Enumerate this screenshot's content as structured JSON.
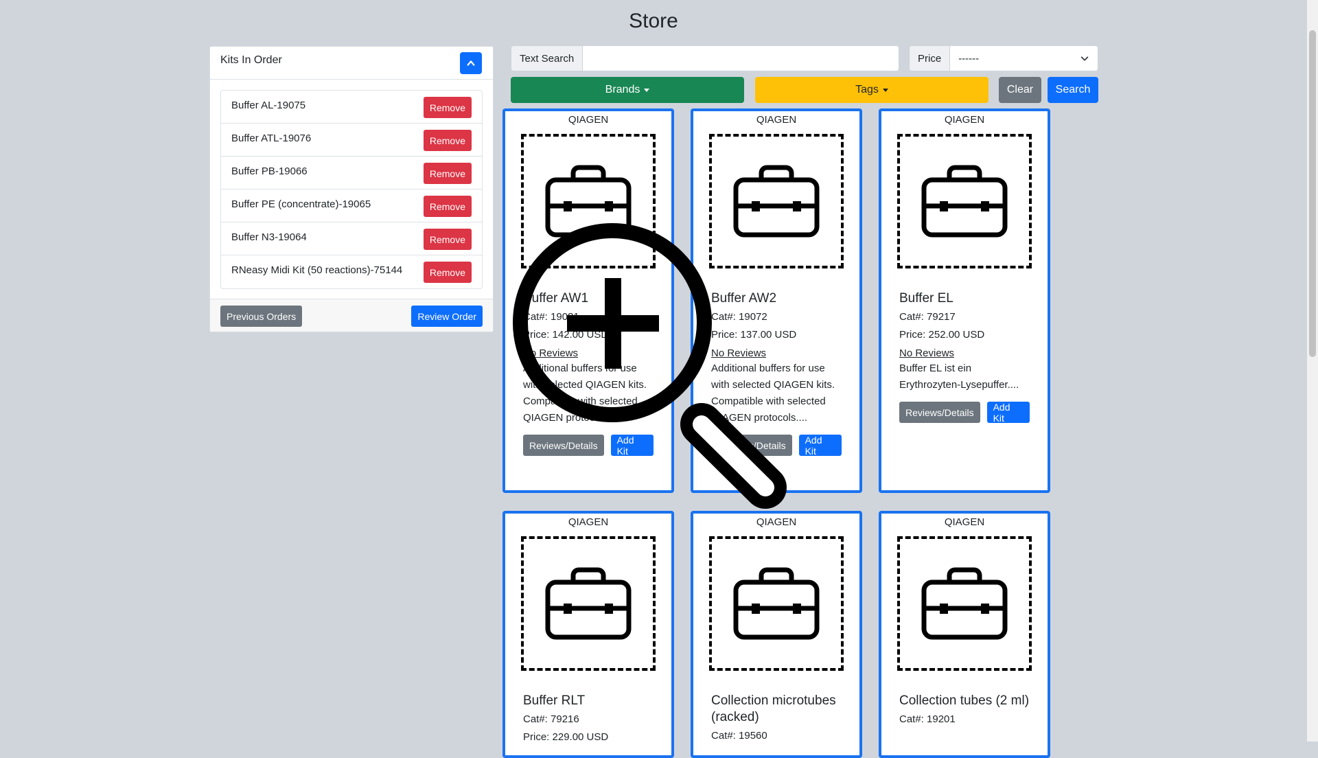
{
  "page": {
    "title": "Store"
  },
  "order_panel": {
    "title": "Kits In Order",
    "items": [
      {
        "name": "Buffer AL-19075",
        "remove_label": "Remove"
      },
      {
        "name": "Buffer ATL-19076",
        "remove_label": "Remove"
      },
      {
        "name": "Buffer PB-19066",
        "remove_label": "Remove"
      },
      {
        "name": "Buffer PE (concentrate)-19065",
        "remove_label": "Remove"
      },
      {
        "name": "Buffer N3-19064",
        "remove_label": "Remove"
      },
      {
        "name": "RNeasy Midi Kit (50 reactions)-75144",
        "remove_label": "Remove"
      }
    ],
    "previous_orders_label": "Previous Orders",
    "review_order_label": "Review Order"
  },
  "filters": {
    "text_search_label": "Text Search",
    "text_search_value": "",
    "price_label": "Price",
    "price_value": "------",
    "brands_label": "Brands",
    "tags_label": "Tags",
    "clear_label": "Clear",
    "search_label": "Search"
  },
  "products": [
    {
      "brand": "QIAGEN",
      "name": "Buffer AW1",
      "cat": "Cat#: 19081",
      "price": "Price: 142.00 USD",
      "reviews": "No Reviews",
      "description": "Additional buffers for use with selected QIAGEN kits. Compatible with selected QIAGEN protocols....",
      "details_label": "Reviews/Details",
      "add_label": "Add Kit"
    },
    {
      "brand": "QIAGEN",
      "name": "Buffer AW2",
      "cat": "Cat#: 19072",
      "price": "Price: 137.00 USD",
      "reviews": "No Reviews",
      "description": "Additional buffers for use with selected QIAGEN kits. Compatible with selected QIAGEN protocols....",
      "details_label": "Reviews/Details",
      "add_label": "Add Kit"
    },
    {
      "brand": "QIAGEN",
      "name": "Buffer EL",
      "cat": "Cat#: 79217",
      "price": "Price: 252.00 USD",
      "reviews": "No Reviews",
      "description": "Buffer EL ist ein Erythrozyten-Lysepuffer....",
      "details_label": "Reviews/Details",
      "add_label": "Add Kit"
    },
    {
      "brand": "QIAGEN",
      "name": "Buffer RLT",
      "cat": "Cat#: 79216",
      "price": "Price: 229.00 USD"
    },
    {
      "brand": "QIAGEN",
      "name": "Collection microtubes (racked)",
      "cat": "Cat#: 19560"
    },
    {
      "brand": "QIAGEN",
      "name": "Collection tubes (2 ml)",
      "cat": "Cat#: 19201"
    }
  ],
  "colors": {
    "background": "#d0d5dc",
    "primary": "#0d6efd",
    "danger": "#dc3545",
    "success": "#198754",
    "warning": "#ffc107",
    "secondary": "#6c757d",
    "card_border": "#1a73f0"
  },
  "icons": {
    "product_image": "briefcase-icon",
    "overlay": "zoom-in-magnifier-icon",
    "collapse": "chevron-up-icon",
    "select": "chevron-down-icon"
  }
}
